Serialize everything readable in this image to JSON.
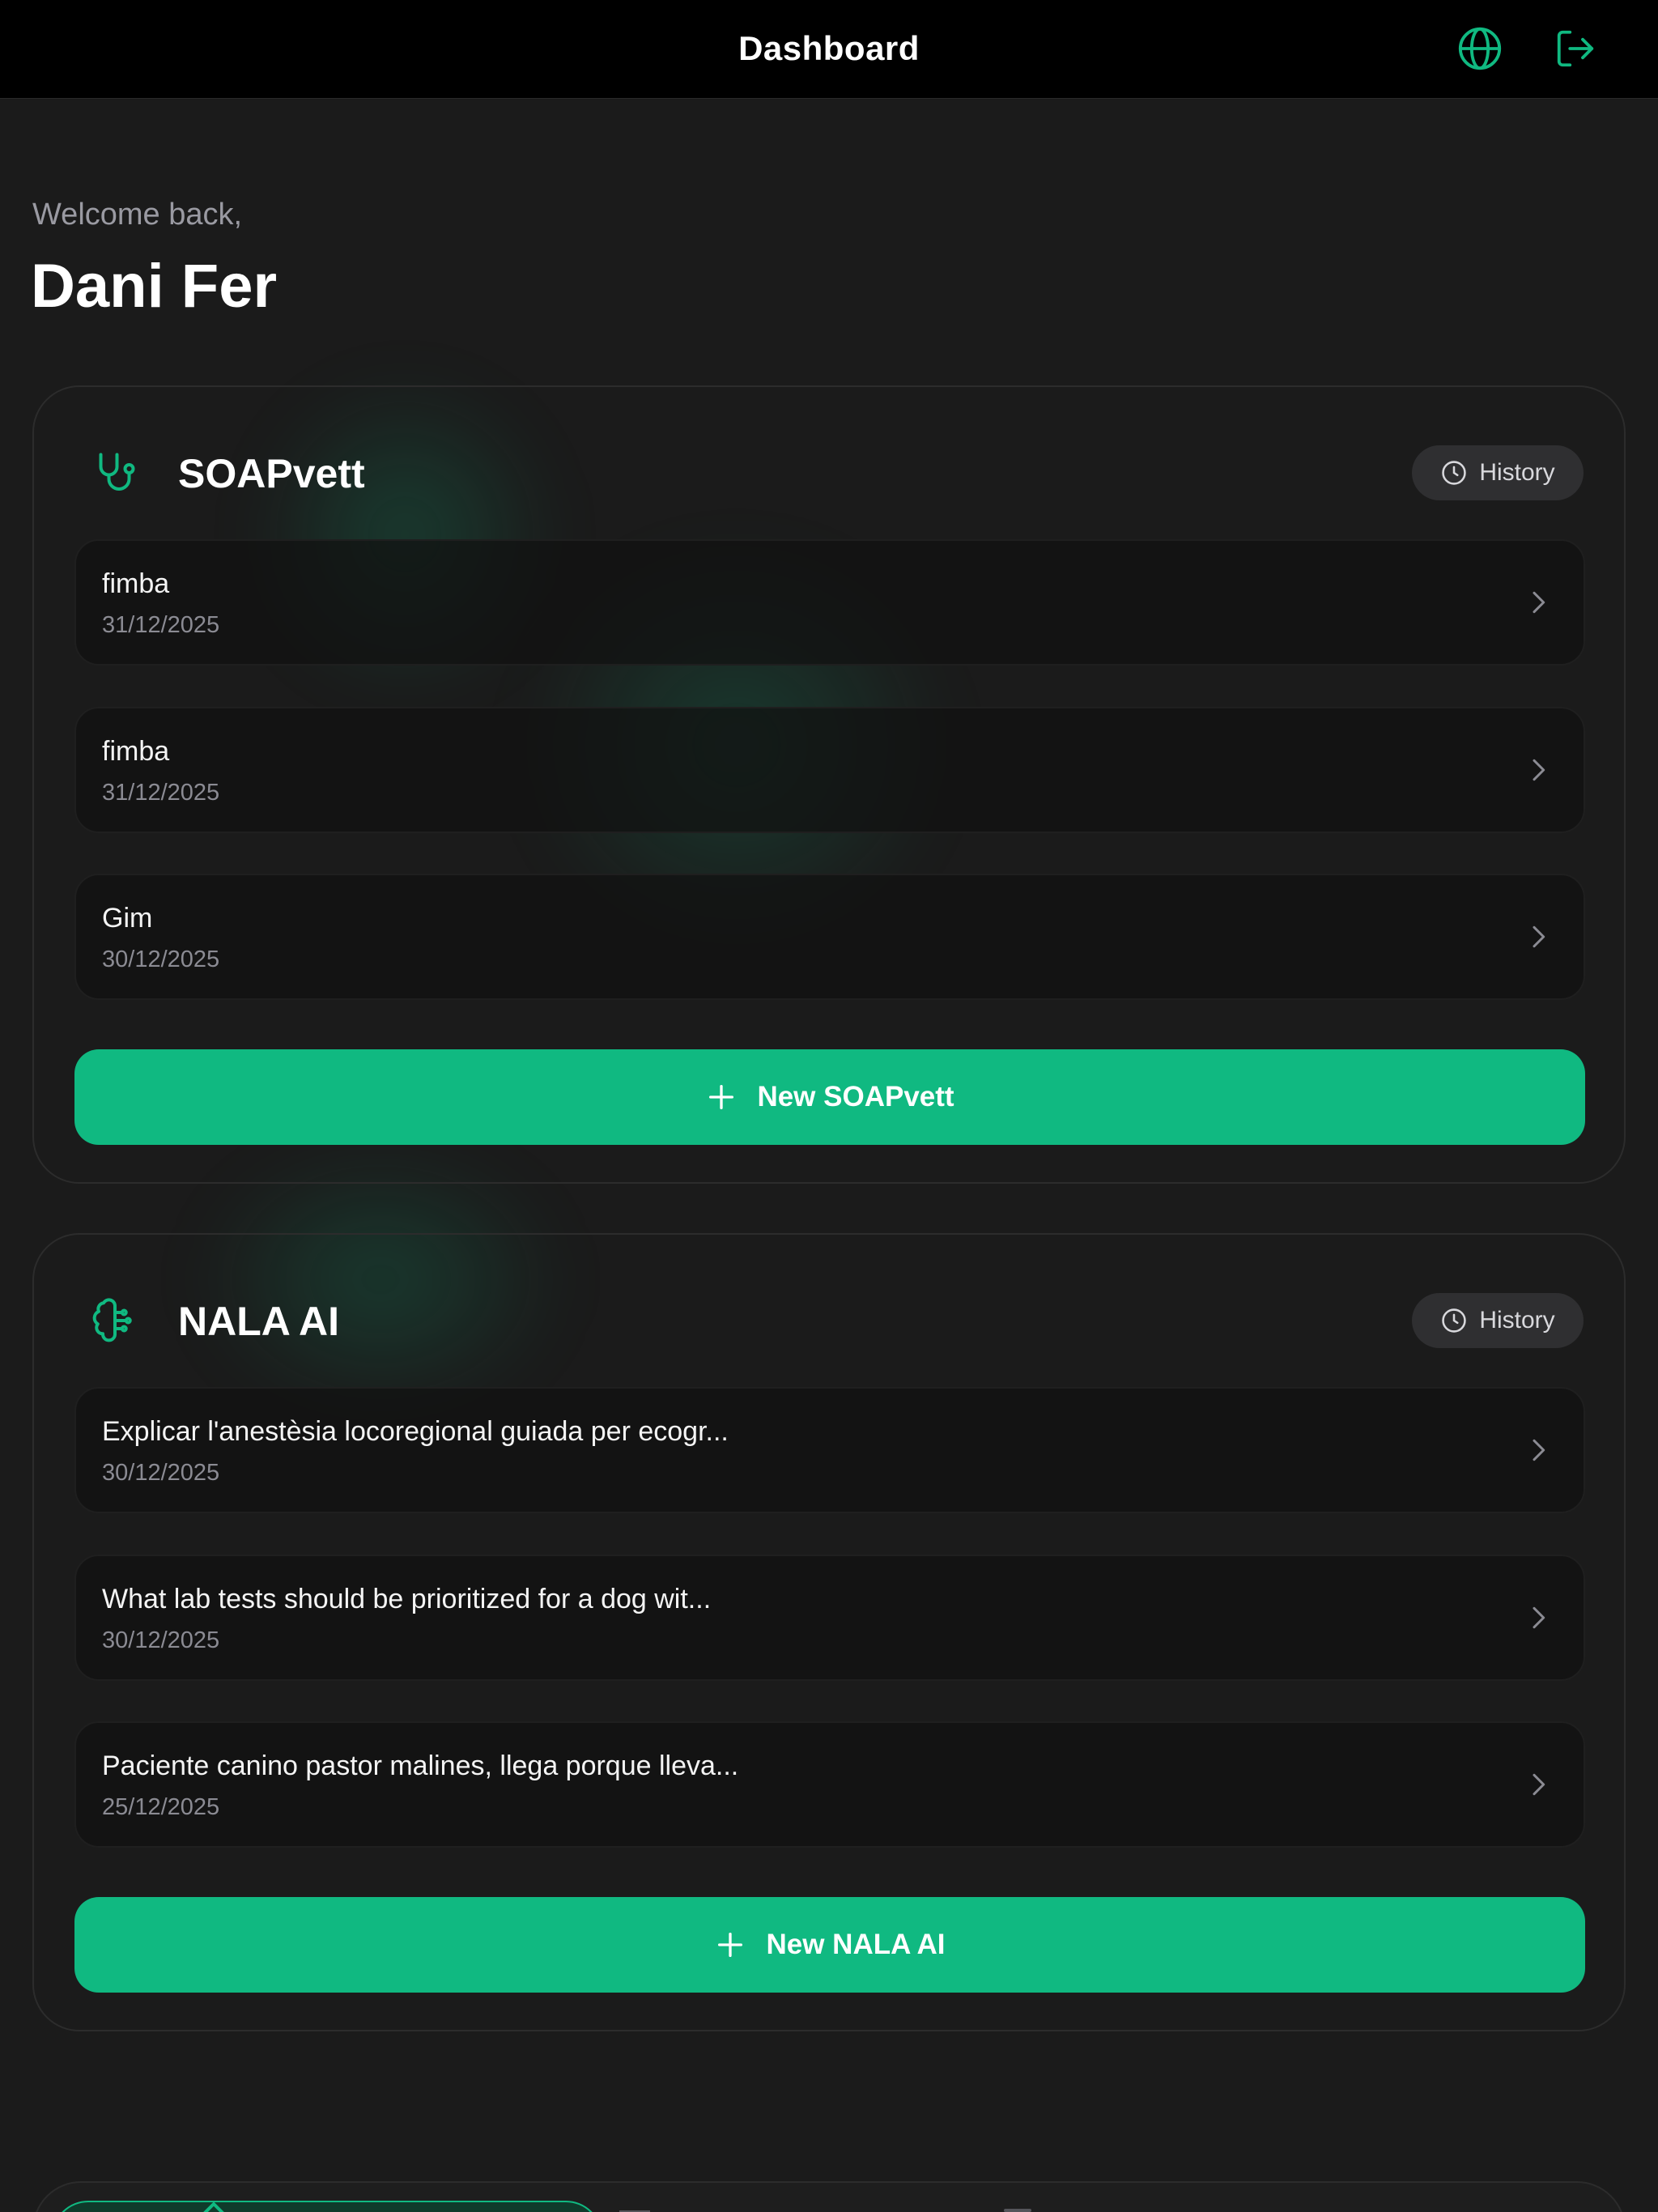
{
  "header": {
    "title": "Dashboard"
  },
  "greeting": {
    "welcome": "Welcome back,",
    "name": "Dani Fer"
  },
  "theme": {
    "accent": "#10b981",
    "background": "#1b1b1b",
    "topbar": "#000000"
  },
  "soapvett": {
    "title": "SOAPvett",
    "icon": "stethoscope-icon",
    "history_label": "History",
    "items": [
      {
        "name": "fimba",
        "date": "31/12/2025"
      },
      {
        "name": "fimba",
        "date": "31/12/2025"
      },
      {
        "name": "Gim",
        "date": "30/12/2025"
      }
    ],
    "new_label": "New SOAPvett"
  },
  "nala": {
    "title": "NALA AI",
    "icon": "brain-icon",
    "history_label": "History",
    "items": [
      {
        "name": "Explicar l'anestèsia locoregional guiada per ecogr...",
        "date": "30/12/2025"
      },
      {
        "name": "What lab tests should be prioritized for a dog wit...",
        "date": "30/12/2025"
      },
      {
        "name": "Paciente canino pastor malines, llega porque lleva...",
        "date": "25/12/2025"
      }
    ],
    "new_label": "New NALA AI"
  }
}
